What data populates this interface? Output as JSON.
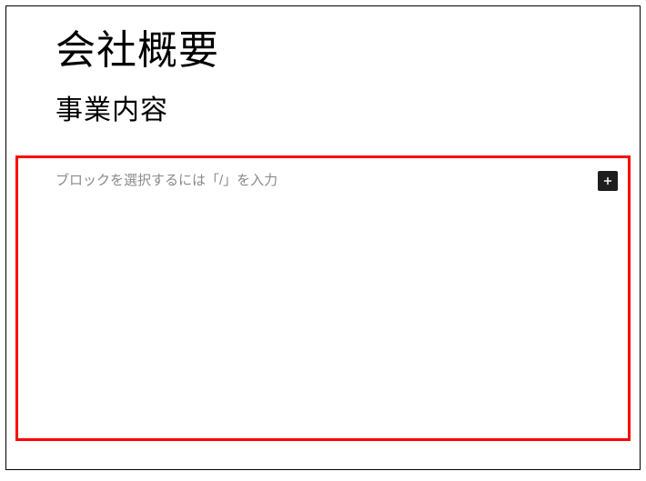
{
  "page": {
    "title": "会社概要"
  },
  "section": {
    "heading": "事業内容"
  },
  "block": {
    "placeholder": "ブロックを選択するには「/」を入力"
  }
}
